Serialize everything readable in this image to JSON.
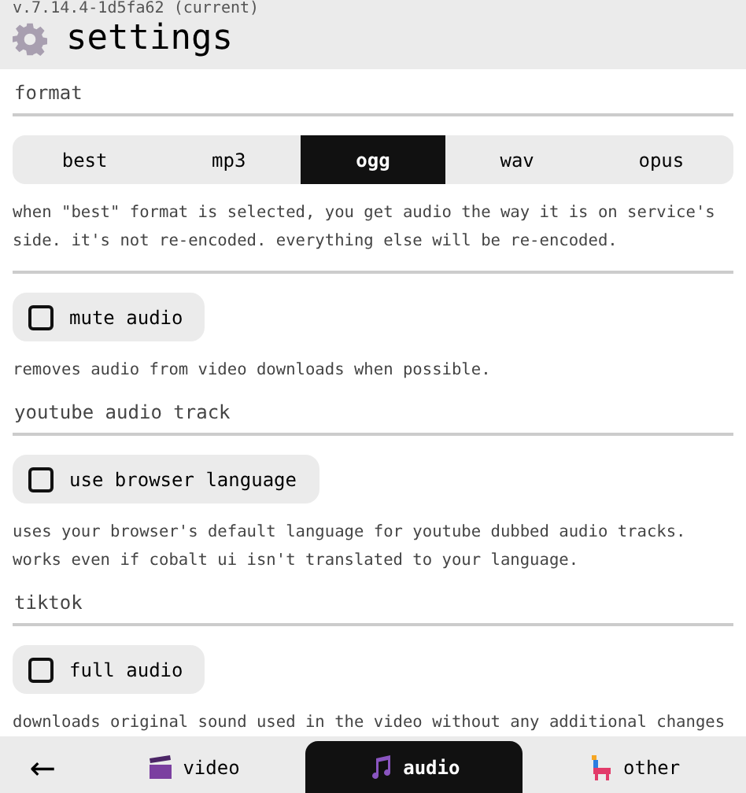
{
  "header": {
    "version": "v.7.14.4-1d5fa62 (current)",
    "title": "settings"
  },
  "sections": [
    {
      "title": "format",
      "items": [
        {
          "kind": "segmented",
          "options": [
            {
              "label": "best",
              "selected": false
            },
            {
              "label": "mp3",
              "selected": false
            },
            {
              "label": "ogg",
              "selected": true
            },
            {
              "label": "wav",
              "selected": false
            },
            {
              "label": "opus",
              "selected": false
            }
          ]
        },
        {
          "kind": "description",
          "text": "when \"best\" format is selected, you get audio the way it is on service's side. it's not re-encoded. everything else will be re-encoded."
        }
      ]
    },
    {
      "items": [
        {
          "kind": "toggle",
          "label": "mute audio",
          "checked": false
        },
        {
          "kind": "description",
          "text": "removes audio from video downloads when possible."
        }
      ]
    },
    {
      "title": "youtube audio track",
      "items": [
        {
          "kind": "toggle",
          "label": "use browser language",
          "checked": false
        },
        {
          "kind": "description",
          "text": "uses your browser's default language for youtube dubbed audio tracks. works even if cobalt ui isn't translated to your language."
        }
      ]
    },
    {
      "title": "tiktok",
      "items": [
        {
          "kind": "toggle",
          "label": "full audio",
          "checked": false
        },
        {
          "kind": "description",
          "text": "downloads original sound used in the video without any additional changes"
        }
      ]
    }
  ],
  "nav": {
    "back": "←",
    "tabs": [
      {
        "kind": "video",
        "label": "video",
        "selected": false
      },
      {
        "kind": "audio",
        "label": "audio",
        "selected": true
      },
      {
        "kind": "other",
        "label": "other",
        "selected": false
      }
    ]
  }
}
